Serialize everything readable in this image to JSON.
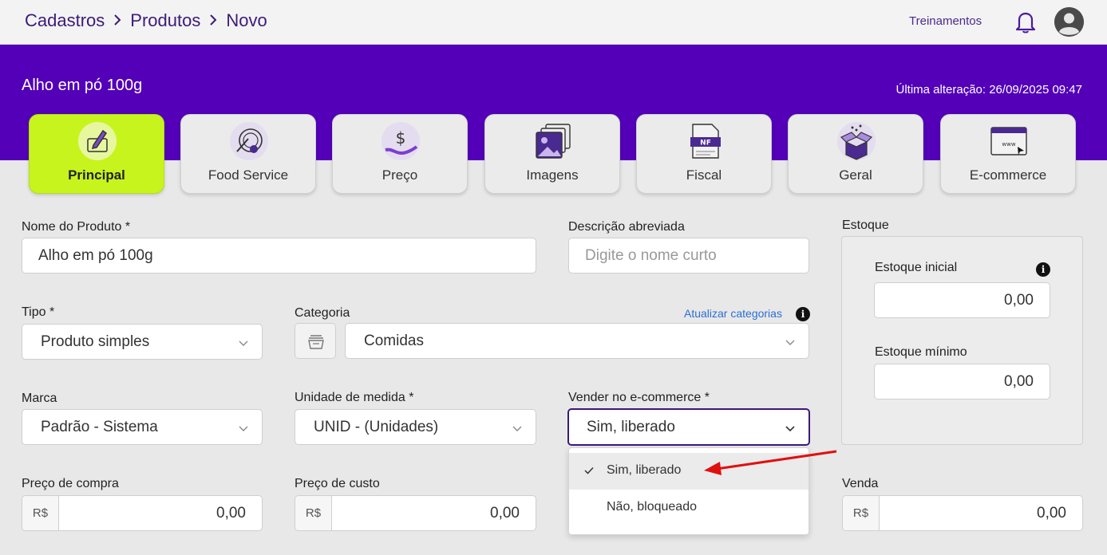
{
  "breadcrumb": [
    "Cadastros",
    "Produtos",
    "Novo"
  ],
  "header": {
    "trainings": "Treinamentos"
  },
  "product": {
    "title": "Alho em pó 100g",
    "last_change": "Última alteração: 26/09/2025 09:47"
  },
  "tabs": [
    {
      "label": "Principal",
      "active": true
    },
    {
      "label": "Food Service"
    },
    {
      "label": "Preço"
    },
    {
      "label": "Imagens"
    },
    {
      "label": "Fiscal"
    },
    {
      "label": "Geral"
    },
    {
      "label": "E-commerce"
    }
  ],
  "form": {
    "name_label": "Nome do Produto *",
    "name_value": "Alho em pó 100g",
    "short_desc_label": "Descrição abreviada",
    "short_desc_placeholder": "Digite o nome curto",
    "type_label": "Tipo *",
    "type_value": "Produto simples",
    "category_label": "Categoria",
    "category_update": "Atualizar categorias",
    "category_value": "Comidas",
    "brand_label": "Marca",
    "brand_value": "Padrão - Sistema",
    "unit_label": "Unidade de medida *",
    "unit_value": "UNID - (Unidades)",
    "ecommerce_label": "Vender no e-commerce *",
    "ecommerce_value": "Sim, liberado",
    "ecommerce_options": [
      "Sim, liberado",
      "Não, bloqueado"
    ],
    "purchase_label": "Preço de compra",
    "purchase_value": "0,00",
    "cost_label": "Preço de custo",
    "cost_value": "0,00",
    "sale_label": "Venda",
    "sale_value": "0,00",
    "currency": "R$"
  },
  "stock": {
    "title": "Estoque",
    "initial_label": "Estoque inicial",
    "initial_value": "0,00",
    "min_label": "Estoque mínimo",
    "min_value": "0,00"
  },
  "colors": {
    "brand": "#5300b8",
    "active_tab": "#c8f41e",
    "link": "#2a6fd6",
    "arrow": "#e01010"
  }
}
